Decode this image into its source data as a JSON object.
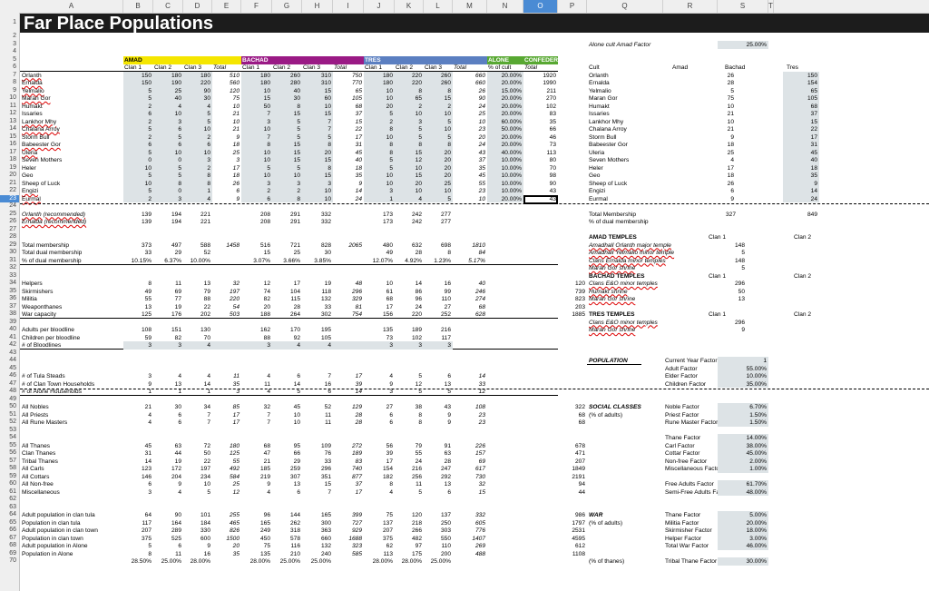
{
  "columns": [
    "A",
    "B",
    "C",
    "D",
    "E",
    "F",
    "G",
    "H",
    "I",
    "J",
    "K",
    "L",
    "M",
    "N",
    "O",
    "P",
    "Q",
    "R",
    "S",
    "T"
  ],
  "selected_column": "O",
  "selected_row": "23",
  "title": "Far Place Populations",
  "alone_cult": {
    "label": "Alone cult Amad Factor",
    "value": "25.00%"
  },
  "groups": {
    "amad": "AMAD",
    "bachad": "BACHAD",
    "tres": "TRES",
    "alone": "ALONE",
    "confed": "CONFEDERATION",
    "alone_temples": "ALONE TEMPLES"
  },
  "colors": {
    "amad": "#f5e600",
    "bachad": "#9a1a85",
    "tres": "#5b7fc1",
    "alone": "#58a832",
    "confed": "#58a832",
    "title_bg": "#1c1c1c",
    "shade": "#dde3e6",
    "q_hdr": "#2e3d5c"
  },
  "sub": {
    "c1": "Clan 1",
    "c2": "Clan 2",
    "c3": "Clan 3",
    "total": "Total",
    "pct": "% of cult",
    "cult": "Cult",
    "amad": "Amad",
    "bachad": "Bachad",
    "tres": "Tres"
  },
  "cults": [
    {
      "name": "Orlanth",
      "amad": [
        "150",
        "180",
        "180",
        "510"
      ],
      "bachad": [
        "180",
        "260",
        "310",
        "750"
      ],
      "tres": [
        "180",
        "220",
        "260",
        "660"
      ],
      "pct": "20.00%",
      "conf": "1920",
      "q": [
        "26",
        "150"
      ]
    },
    {
      "name": "Ernalda",
      "amad": [
        "150",
        "190",
        "220",
        "560"
      ],
      "bachad": [
        "180",
        "280",
        "310",
        "770"
      ],
      "tres": [
        "180",
        "220",
        "260",
        "660"
      ],
      "pct": "20.00%",
      "conf": "1990",
      "q": [
        "28",
        "154"
      ]
    },
    {
      "name": "Yelmalio",
      "amad": [
        "5",
        "25",
        "90",
        "120"
      ],
      "bachad": [
        "10",
        "40",
        "15",
        "65"
      ],
      "tres": [
        "10",
        "8",
        "8",
        "26"
      ],
      "pct": "15.00%",
      "conf": "211",
      "q": [
        "5",
        "65"
      ]
    },
    {
      "name": "Maran Gor",
      "amad": [
        "5",
        "40",
        "30",
        "75"
      ],
      "bachad": [
        "15",
        "30",
        "60",
        "105"
      ],
      "tres": [
        "10",
        "65",
        "15",
        "90"
      ],
      "pct": "20.00%",
      "conf": "270",
      "q": [
        "75",
        "105"
      ]
    },
    {
      "name": "Humakt",
      "amad": [
        "2",
        "4",
        "4",
        "10"
      ],
      "bachad": [
        "50",
        "8",
        "10",
        "68"
      ],
      "tres": [
        "20",
        "2",
        "2",
        "24"
      ],
      "pct": "20.00%",
      "conf": "102",
      "q": [
        "10",
        "68"
      ]
    },
    {
      "name": "Issaries",
      "amad": [
        "6",
        "10",
        "5",
        "21"
      ],
      "bachad": [
        "7",
        "15",
        "15",
        "37"
      ],
      "tres": [
        "5",
        "10",
        "10",
        "25"
      ],
      "pct": "20.00%",
      "conf": "83",
      "q": [
        "21",
        "37"
      ]
    },
    {
      "name": "Lankhor Mhy",
      "amad": [
        "2",
        "3",
        "5",
        "10"
      ],
      "bachad": [
        "3",
        "5",
        "7",
        "15"
      ],
      "tres": [
        "2",
        "3",
        "5",
        "10"
      ],
      "pct": "60.00%",
      "conf": "35",
      "q": [
        "10",
        "15"
      ]
    },
    {
      "name": "Chalana Arroy",
      "amad": [
        "5",
        "6",
        "10",
        "21"
      ],
      "bachad": [
        "10",
        "5",
        "7",
        "22"
      ],
      "tres": [
        "8",
        "5",
        "10",
        "23"
      ],
      "pct": "50.00%",
      "conf": "66",
      "q": [
        "21",
        "22"
      ]
    },
    {
      "name": "Storm Bull",
      "amad": [
        "2",
        "5",
        "2",
        "9"
      ],
      "bachad": [
        "7",
        "5",
        "5",
        "17"
      ],
      "tres": [
        "10",
        "5",
        "5",
        "20"
      ],
      "pct": "20.00%",
      "conf": "46",
      "q": [
        "9",
        "17"
      ]
    },
    {
      "name": "Babeester Gor",
      "amad": [
        "6",
        "6",
        "6",
        "18"
      ],
      "bachad": [
        "8",
        "15",
        "8",
        "31"
      ],
      "tres": [
        "8",
        "8",
        "8",
        "24"
      ],
      "pct": "20.00%",
      "conf": "73",
      "q": [
        "18",
        "31"
      ]
    },
    {
      "name": "Uleria",
      "amad": [
        "5",
        "10",
        "10",
        "25"
      ],
      "bachad": [
        "10",
        "15",
        "20",
        "45"
      ],
      "tres": [
        "8",
        "15",
        "20",
        "43"
      ],
      "pct": "40.00%",
      "conf": "113",
      "q": [
        "25",
        "45"
      ]
    },
    {
      "name": "Seven Mothers",
      "amad": [
        "0",
        "0",
        "3",
        "3"
      ],
      "bachad": [
        "10",
        "15",
        "15",
        "40"
      ],
      "tres": [
        "5",
        "12",
        "20",
        "37"
      ],
      "pct": "10.00%",
      "conf": "80",
      "q": [
        "4",
        "40"
      ]
    },
    {
      "name": "Heler",
      "amad": [
        "10",
        "5",
        "2",
        "17"
      ],
      "bachad": [
        "5",
        "5",
        "8",
        "18"
      ],
      "tres": [
        "5",
        "10",
        "20",
        "35"
      ],
      "pct": "10.00%",
      "conf": "70",
      "q": [
        "17",
        "18"
      ]
    },
    {
      "name": "Geo",
      "amad": [
        "5",
        "5",
        "8",
        "18"
      ],
      "bachad": [
        "10",
        "10",
        "15",
        "35"
      ],
      "tres": [
        "10",
        "15",
        "20",
        "45"
      ],
      "pct": "10.00%",
      "conf": "98",
      "q": [
        "18",
        "35"
      ]
    },
    {
      "name": "Sheep of Luck",
      "amad": [
        "10",
        "8",
        "8",
        "26"
      ],
      "bachad": [
        "3",
        "3",
        "3",
        "9"
      ],
      "tres": [
        "10",
        "20",
        "25",
        "55"
      ],
      "pct": "10.00%",
      "conf": "90",
      "q": [
        "26",
        "9"
      ]
    },
    {
      "name": "Engizi",
      "amad": [
        "5",
        "0",
        "1",
        "6"
      ],
      "bachad": [
        "2",
        "2",
        "10",
        "14"
      ],
      "tres": [
        "3",
        "10",
        "10",
        "23"
      ],
      "pct": "10.00%",
      "conf": "43",
      "q": [
        "6",
        "14"
      ]
    },
    {
      "name": "Eurmal",
      "amad": [
        "2",
        "3",
        "4",
        "9"
      ],
      "bachad": [
        "6",
        "8",
        "10",
        "24"
      ],
      "tres": [
        "1",
        "4",
        "5",
        "10"
      ],
      "pct": "20.00%",
      "conf": "43",
      "q": [
        "9",
        "24"
      ]
    }
  ],
  "rows": [
    {
      "n": "25",
      "label": "Orlanth (recommended)",
      "it": true,
      "vals": [
        "139",
        "194",
        "221",
        "",
        "208",
        "291",
        "332",
        "",
        "173",
        "242",
        "277",
        "",
        "",
        "",
        ""
      ]
    },
    {
      "n": "26",
      "label": "Ernalda (recommended)",
      "it": true,
      "vals": [
        "139",
        "194",
        "221",
        "",
        "208",
        "291",
        "332",
        "",
        "173",
        "242",
        "277",
        "",
        "",
        "",
        ""
      ]
    },
    {
      "n": "29",
      "label": "Total membership",
      "vals": [
        "373",
        "497",
        "588",
        "1458",
        "516",
        "721",
        "828",
        "2065",
        "480",
        "632",
        "698",
        "1810",
        "",
        "",
        ""
      ]
    },
    {
      "n": "30",
      "label": "Total dual membership",
      "vals": [
        "33",
        "29",
        "52",
        "",
        "15",
        "25",
        "30",
        "",
        "49",
        "28",
        "8",
        "84",
        "",
        "",
        ""
      ]
    },
    {
      "n": "31",
      "label": "% of dual membership",
      "vals": [
        "10.15%",
        "6.37%",
        "10.00%",
        "",
        "3.07%",
        "3.66%",
        "3.85%",
        "",
        "12.07%",
        "4.92%",
        "1.23%",
        "5.17%",
        "",
        "",
        ""
      ]
    },
    {
      "n": "34",
      "label": "Helpers",
      "vals": [
        "8",
        "11",
        "13",
        "32",
        "12",
        "17",
        "19",
        "48",
        "10",
        "14",
        "16",
        "40",
        "",
        "",
        "120"
      ]
    },
    {
      "n": "35",
      "label": "Skirmishers",
      "vals": [
        "49",
        "69",
        "79",
        "197",
        "74",
        "104",
        "118",
        "296",
        "61",
        "86",
        "99",
        "246",
        "",
        "",
        "739"
      ]
    },
    {
      "n": "36",
      "label": "Militia",
      "vals": [
        "55",
        "77",
        "88",
        "220",
        "82",
        "115",
        "132",
        "329",
        "68",
        "96",
        "110",
        "274",
        "",
        "",
        "823"
      ]
    },
    {
      "n": "37",
      "label": "Weaponthanes",
      "vals": [
        "13",
        "19",
        "22",
        "54",
        "20",
        "28",
        "33",
        "81",
        "17",
        "24",
        "27",
        "68",
        "",
        "",
        "203"
      ]
    },
    {
      "n": "38",
      "label": "War capacity",
      "vals": [
        "125",
        "176",
        "202",
        "503",
        "188",
        "264",
        "302",
        "754",
        "156",
        "220",
        "252",
        "628",
        "",
        "",
        "1885"
      ]
    },
    {
      "n": "40",
      "label": "Adults per bloodline",
      "vals": [
        "108",
        "151",
        "130",
        "",
        "162",
        "170",
        "195",
        "",
        "135",
        "189",
        "216",
        "",
        "",
        "",
        ""
      ]
    },
    {
      "n": "41",
      "label": "Children per bloodline",
      "vals": [
        "59",
        "82",
        "70",
        "",
        "88",
        "92",
        "105",
        "",
        "73",
        "102",
        "117",
        "",
        "",
        "",
        ""
      ]
    },
    {
      "n": "42",
      "label": "# of Bloodlines",
      "vals": [
        "3",
        "3",
        "4",
        "",
        "3",
        "4",
        "4",
        "",
        "3",
        "3",
        "3",
        "",
        "",
        "",
        ""
      ]
    },
    {
      "n": "46",
      "label": "# of Tula Steads",
      "vals": [
        "3",
        "4",
        "4",
        "11",
        "4",
        "6",
        "7",
        "17",
        "4",
        "5",
        "6",
        "14",
        "",
        "",
        ""
      ]
    },
    {
      "n": "47",
      "label": "# of Clan Town Households",
      "vals": [
        "9",
        "13",
        "14",
        "35",
        "11",
        "14",
        "16",
        "39",
        "9",
        "12",
        "13",
        "33",
        "",
        "",
        ""
      ]
    },
    {
      "n": "48",
      "label": "# of Alone Households",
      "vals": [
        "1",
        "1",
        "1",
        "3",
        "4",
        "5",
        "6",
        "14",
        "3",
        "5",
        "5",
        "12",
        "",
        "",
        ""
      ]
    },
    {
      "n": "50",
      "label": "All Nobles",
      "vals": [
        "21",
        "30",
        "34",
        "85",
        "32",
        "45",
        "52",
        "129",
        "27",
        "38",
        "43",
        "108",
        "",
        "",
        "322"
      ]
    },
    {
      "n": "51",
      "label": "All Priests",
      "vals": [
        "4",
        "6",
        "7",
        "17",
        "7",
        "10",
        "11",
        "28",
        "6",
        "8",
        "9",
        "23",
        "",
        "",
        "68"
      ]
    },
    {
      "n": "52",
      "label": "All Rune Masters",
      "vals": [
        "4",
        "6",
        "7",
        "17",
        "7",
        "10",
        "11",
        "28",
        "6",
        "8",
        "9",
        "23",
        "",
        "",
        "68"
      ]
    },
    {
      "n": "55",
      "label": "All Thanes",
      "vals": [
        "45",
        "63",
        "72",
        "180",
        "68",
        "95",
        "109",
        "272",
        "56",
        "79",
        "91",
        "226",
        "",
        "",
        "678"
      ]
    },
    {
      "n": "56",
      "label": "Clan Thanes",
      "vals": [
        "31",
        "44",
        "50",
        "125",
        "47",
        "66",
        "76",
        "189",
        "39",
        "55",
        "63",
        "157",
        "",
        "",
        "471"
      ]
    },
    {
      "n": "57",
      "label": "Tribal Thanes",
      "vals": [
        "14",
        "19",
        "22",
        "55",
        "21",
        "29",
        "33",
        "83",
        "17",
        "24",
        "28",
        "69",
        "",
        "",
        "207"
      ]
    },
    {
      "n": "58",
      "label": "All Carls",
      "vals": [
        "123",
        "172",
        "197",
        "492",
        "185",
        "259",
        "296",
        "740",
        "154",
        "216",
        "247",
        "617",
        "",
        "",
        "1849"
      ]
    },
    {
      "n": "59",
      "label": "All Cottars",
      "vals": [
        "146",
        "204",
        "234",
        "584",
        "219",
        "307",
        "351",
        "877",
        "182",
        "256",
        "292",
        "730",
        "",
        "",
        "2191"
      ]
    },
    {
      "n": "60",
      "label": "All Non-free",
      "vals": [
        "6",
        "9",
        "10",
        "25",
        "9",
        "13",
        "15",
        "37",
        "8",
        "11",
        "13",
        "32",
        "",
        "",
        "94"
      ]
    },
    {
      "n": "61",
      "label": "Miscellaneous",
      "vals": [
        "3",
        "4",
        "5",
        "12",
        "4",
        "6",
        "7",
        "17",
        "4",
        "5",
        "6",
        "15",
        "",
        "",
        "44"
      ]
    },
    {
      "n": "64",
      "label": "Adult population in clan tula",
      "vals": [
        "64",
        "90",
        "101",
        "255",
        "96",
        "144",
        "165",
        "399",
        "75",
        "120",
        "137",
        "332",
        "",
        "",
        "986"
      ]
    },
    {
      "n": "65",
      "label": "Population in clan tula",
      "vals": [
        "117",
        "164",
        "184",
        "465",
        "165",
        "262",
        "300",
        "727",
        "137",
        "218",
        "250",
        "605",
        "",
        "",
        "1797"
      ]
    },
    {
      "n": "66",
      "label": "Adult population in clan town",
      "vals": [
        "207",
        "289",
        "330",
        "826",
        "249",
        "318",
        "363",
        "929",
        "207",
        "266",
        "303",
        "776",
        "",
        "",
        "2531"
      ]
    },
    {
      "n": "67",
      "label": "Population in clan town",
      "vals": [
        "375",
        "525",
        "600",
        "1500",
        "450",
        "578",
        "660",
        "1688",
        "375",
        "482",
        "550",
        "1407",
        "",
        "",
        "4595"
      ]
    },
    {
      "n": "68",
      "label": "Adult population in Alone",
      "vals": [
        "5",
        "6",
        "9",
        "20",
        "75",
        "116",
        "132",
        "323",
        "62",
        "97",
        "110",
        "269",
        "",
        "",
        "612"
      ]
    },
    {
      "n": "69",
      "label": "Population in Alone",
      "vals": [
        "8",
        "11",
        "16",
        "35",
        "135",
        "210",
        "240",
        "585",
        "113",
        "175",
        "200",
        "488",
        "",
        "",
        "1108"
      ]
    }
  ],
  "right_header_rows": [
    "Clan 1",
    "Clan 2"
  ],
  "amad_temples": {
    "title": "AMAD TEMPLES",
    "items": [
      {
        "label": "Amadhall Orlanth major temple",
        "v": "148"
      },
      {
        "label": "Amadhall Yelmalio minor temple",
        "v": "5"
      },
      {
        "label": "Clans Ernalda minor temples",
        "v": "148"
      },
      {
        "label": "Maran Gor shrine",
        "v": "5"
      }
    ]
  },
  "bachad_temples": {
    "title": "BACHAD TEMPLES",
    "items": [
      {
        "label": "Clans E&O minor temples",
        "v": "296"
      },
      {
        "label": "Humakt shrine",
        "v": "50"
      },
      {
        "label": "Maran Gor shrine",
        "v": "13"
      }
    ]
  },
  "tres_temples": {
    "title": "TRES TEMPLES",
    "items": [
      {
        "label": "Clans E&O minor temples",
        "v": "296"
      },
      {
        "label": "Maran Gor shrine",
        "v": "9"
      }
    ]
  },
  "membership": {
    "total_label": "Total Membership",
    "amad": "327",
    "bachad": "849",
    "dual_label": "% of dual membership"
  },
  "population": {
    "title": "POPULATION",
    "items": [
      {
        "label": "Current Year Factor",
        "v": "1"
      },
      {
        "label": "Adult Factor",
        "v": "55.00%"
      },
      {
        "label": "Elder Factor",
        "v": "10.00%"
      },
      {
        "label": "Children Factor",
        "v": "35.00%"
      }
    ]
  },
  "social": {
    "title": "SOCIAL CLASSES",
    "sub": "(% of adults)",
    "items": [
      {
        "label": "Noble Factor",
        "v": "6.70%"
      },
      {
        "label": "Priest Factor",
        "v": "1.50%"
      },
      {
        "label": "Rune Master Factor",
        "v": "1.50%"
      },
      {
        "label": "Thane Factor",
        "v": "14.00%"
      },
      {
        "label": "Carl Factor",
        "v": "38.00%"
      },
      {
        "label": "Cottar Factor",
        "v": "45.00%"
      },
      {
        "label": "Non-free Factor",
        "v": "2.00%"
      },
      {
        "label": "Miscellaneous Factor",
        "v": "1.00%"
      },
      {
        "label": "Free Adults Factor",
        "v": "61.70%"
      },
      {
        "label": "Semi-Free Adults Factor",
        "v": "48.00%"
      }
    ]
  },
  "war": {
    "title": "WAR",
    "sub": "(% of adults)",
    "items": [
      {
        "label": "Thane Factor",
        "v": "5.00%"
      },
      {
        "label": "Militia Factor",
        "v": "20.00%"
      },
      {
        "label": "Skirmisher Factor",
        "v": "18.00%"
      },
      {
        "label": "Helper Factor",
        "v": "3.00%"
      },
      {
        "label": "Total War Factor",
        "v": "46.00%"
      }
    ],
    "thanes_label": "(% of thanes)",
    "tribal_label": "Tribal Thane Factor",
    "tribal_v": "30.00%"
  },
  "row70": [
    "28.50%",
    "25.00%",
    "28.00%",
    "",
    "28.00%",
    "25.00%",
    "25.00%",
    "",
    "28.00%",
    "28.00%",
    "25.00%"
  ]
}
